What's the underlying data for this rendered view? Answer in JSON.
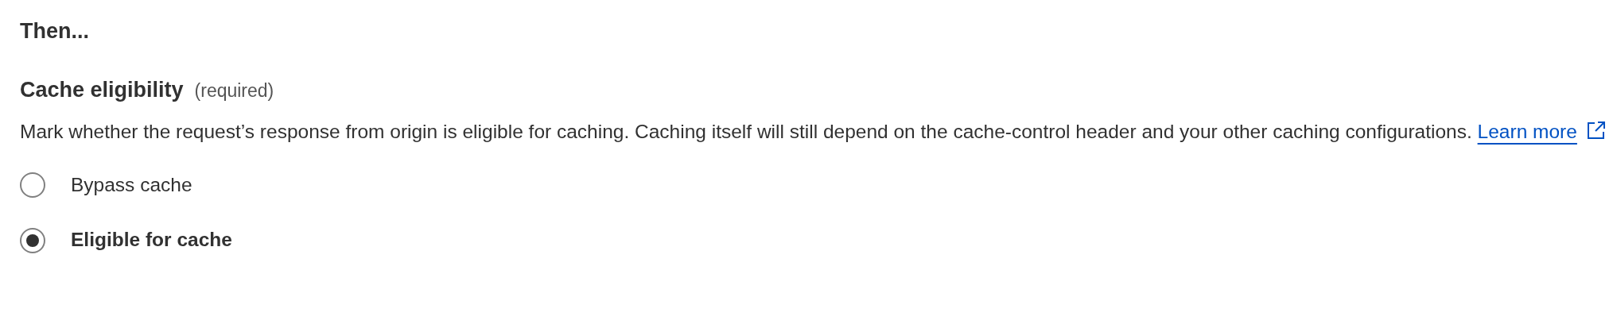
{
  "section_title": "Then...",
  "field": {
    "label": "Cache eligibility",
    "hint": "(required)",
    "description": "Mark whether the request’s response from origin is eligible for caching. Caching itself will still depend on the cache-control header and your other caching configurations.",
    "link": "Learn more"
  },
  "options": [
    {
      "label": "Bypass cache",
      "selected": false
    },
    {
      "label": "Eligible for cache",
      "selected": true
    }
  ]
}
